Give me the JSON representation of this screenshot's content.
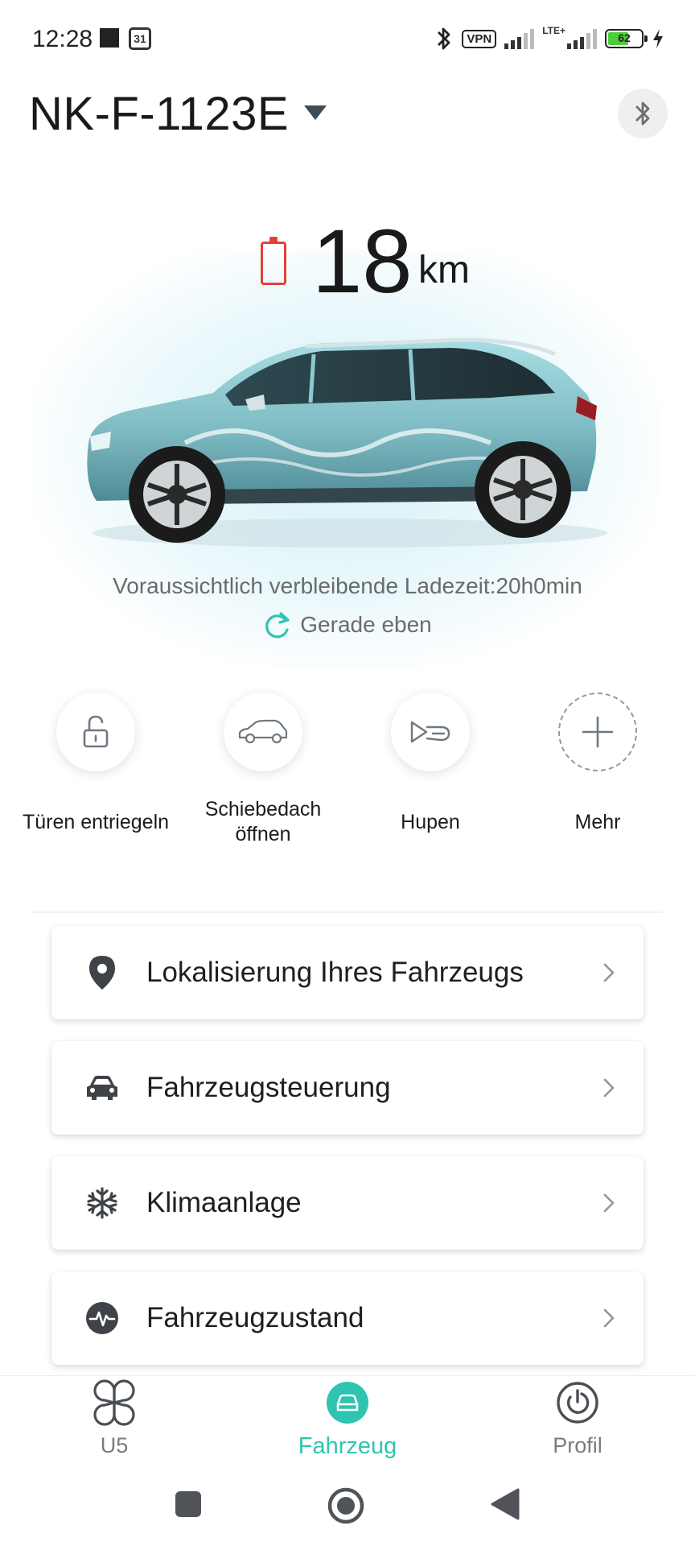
{
  "status_bar": {
    "time": "12:28",
    "calendar_day": "31",
    "vpn": "VPN",
    "network": "LTE+",
    "battery_percent": "62",
    "battery_level": 0.62
  },
  "header": {
    "vehicle_plate": "NK-F-1123E"
  },
  "range": {
    "value": "18",
    "unit": "km"
  },
  "charging": {
    "remaining_time": "Voraussichtlich verbleibende Ladezeit:20h0min",
    "updated": "Gerade eben"
  },
  "quick_actions": [
    {
      "label": "Türen entriegeln",
      "icon": "unlock-icon"
    },
    {
      "label": "Schiebedach öffnen",
      "icon": "car-roof-icon"
    },
    {
      "label": "Hupen",
      "icon": "horn-icon"
    },
    {
      "label": "Mehr",
      "icon": "plus-icon"
    }
  ],
  "menu": [
    {
      "label": "Lokalisierung Ihres Fahrzeugs",
      "icon": "location-pin-icon"
    },
    {
      "label": "Fahrzeugsteuerung",
      "icon": "car-icon"
    },
    {
      "label": "Klimaanlage",
      "icon": "snowflake-icon"
    },
    {
      "label": "Fahrzeugzustand",
      "icon": "pulse-icon"
    }
  ],
  "bottom_nav": [
    {
      "label": "U5",
      "icon": "grid-clover-icon",
      "active": false
    },
    {
      "label": "Fahrzeug",
      "icon": "car-icon",
      "active": true
    },
    {
      "label": "Profil",
      "icon": "profile-dial-icon",
      "active": false
    }
  ],
  "colors": {
    "accent": "#2ec4b0",
    "range_battery": "#e0413a",
    "car_body": "#8fc9cf"
  }
}
